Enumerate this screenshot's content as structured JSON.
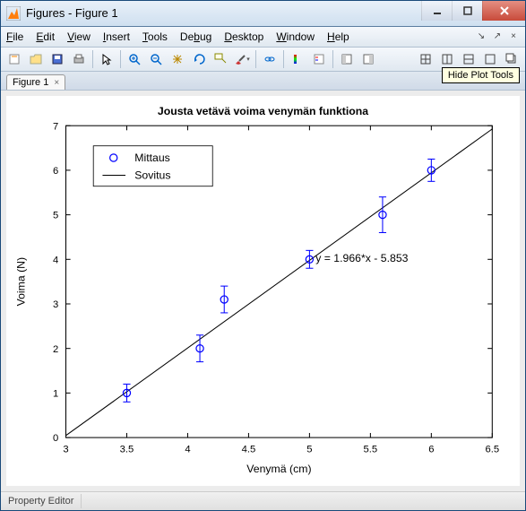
{
  "window": {
    "title": "Figures - Figure 1",
    "tooltip": "Hide Plot Tools"
  },
  "menu": {
    "file": "File",
    "edit": "Edit",
    "view": "View",
    "insert": "Insert",
    "tools": "Tools",
    "debug": "Debug",
    "desktop": "Desktop",
    "window": "Window",
    "help": "Help"
  },
  "tab": {
    "label": "Figure 1"
  },
  "status": {
    "prop_editor": "Property Editor"
  },
  "chart_data": {
    "type": "scatter_with_fit",
    "title": "Jousta vetävä voima venymän funktiona",
    "xlabel": "Venymä (cm)",
    "ylabel": "Voima (N)",
    "xlim": [
      3,
      6.5
    ],
    "ylim": [
      0,
      7
    ],
    "xticks": [
      3,
      3.5,
      4,
      4.5,
      5,
      5.5,
      6,
      6.5
    ],
    "yticks": [
      0,
      1,
      2,
      3,
      4,
      5,
      6,
      7
    ],
    "series": [
      {
        "name": "Mittaus",
        "type": "errorbar-circle",
        "color": "#0000ff",
        "x": [
          3.5,
          4.1,
          4.3,
          5.0,
          5.6,
          6.0
        ],
        "y": [
          1.0,
          2.0,
          3.1,
          4.0,
          5.0,
          6.0
        ],
        "yerr": [
          0.2,
          0.3,
          0.3,
          0.2,
          0.4,
          0.25
        ]
      },
      {
        "name": "Sovitus",
        "type": "line",
        "color": "#000000",
        "slope": 1.966,
        "intercept": -5.853
      }
    ],
    "annotation": {
      "text": "y = 1.966*x - 5.853",
      "x": 5.05,
      "y": 3.95
    },
    "legend": {
      "items": [
        "Mittaus",
        "Sovitus"
      ],
      "position": "upper-left"
    }
  }
}
